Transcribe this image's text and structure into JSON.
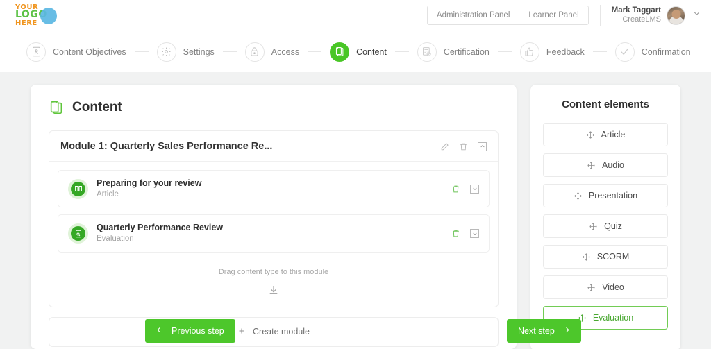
{
  "header": {
    "logo": {
      "line1": "YOUR",
      "line2": "LOGO",
      "line3": "HERE",
      "icon": "logo-circle-icon"
    },
    "admin_panel_label": "Administration Panel",
    "learner_panel_label": "Learner Panel",
    "user_name": "Mark Taggart",
    "user_org": "CreateLMS",
    "avatar_icon": "user-avatar",
    "chevron_icon": "chevron-down-icon"
  },
  "stepper": {
    "steps": [
      {
        "label": "Content Objectives",
        "icon": "objectives-icon",
        "active": false
      },
      {
        "label": "Settings",
        "icon": "gear-icon",
        "active": false
      },
      {
        "label": "Access",
        "icon": "lock-icon",
        "active": false
      },
      {
        "label": "Content",
        "icon": "clipboard-icon",
        "active": true
      },
      {
        "label": "Certification",
        "icon": "certificate-icon",
        "active": false
      },
      {
        "label": "Feedback",
        "icon": "thumbs-up-icon",
        "active": false
      },
      {
        "label": "Confirmation",
        "icon": "check-icon",
        "active": false
      }
    ]
  },
  "content_panel": {
    "title": "Content",
    "title_icon": "clipboard-icon",
    "module": {
      "name": "Module 1: Quarterly Sales Performance Re...",
      "edit_icon": "pencil-icon",
      "delete_icon": "trash-icon",
      "collapse_icon": "collapse-icon",
      "items": [
        {
          "title": "Preparing for your review",
          "subtitle": "Article",
          "icon": "book-icon",
          "delete_icon": "trash-icon",
          "expand_icon": "chevron-down-box-icon"
        },
        {
          "title": "Quarterly Performance Review",
          "subtitle": "Evaluation",
          "icon": "evaluation-icon",
          "delete_icon": "trash-icon",
          "expand_icon": "chevron-down-box-icon"
        }
      ],
      "dropzone_text": "Drag content type to this module",
      "dropzone_icon": "download-drop-icon"
    },
    "create_module_label": "Create module",
    "create_module_icon": "plus-icon"
  },
  "side_panel": {
    "title": "Content elements",
    "elements": [
      {
        "label": "Article",
        "icon": "move-icon",
        "highlight": false
      },
      {
        "label": "Audio",
        "icon": "move-icon",
        "highlight": false
      },
      {
        "label": "Presentation",
        "icon": "move-icon",
        "highlight": false
      },
      {
        "label": "Quiz",
        "icon": "move-icon",
        "highlight": false
      },
      {
        "label": "SCORM",
        "icon": "move-icon",
        "highlight": false
      },
      {
        "label": "Video",
        "icon": "move-icon",
        "highlight": false
      },
      {
        "label": "Evaluation",
        "icon": "move-icon",
        "highlight": true
      }
    ]
  },
  "footer": {
    "previous_label": "Previous step",
    "previous_icon": "arrow-left-icon",
    "next_label": "Next step",
    "next_icon": "arrow-right-icon"
  },
  "colors": {
    "accent_green": "#4dc72b",
    "active_green": "#49c626",
    "highlight_green": "#72cc55",
    "logo_orange": "#f0951f",
    "logo_blue": "#5bb7e3",
    "background": "#f1f2f2"
  }
}
